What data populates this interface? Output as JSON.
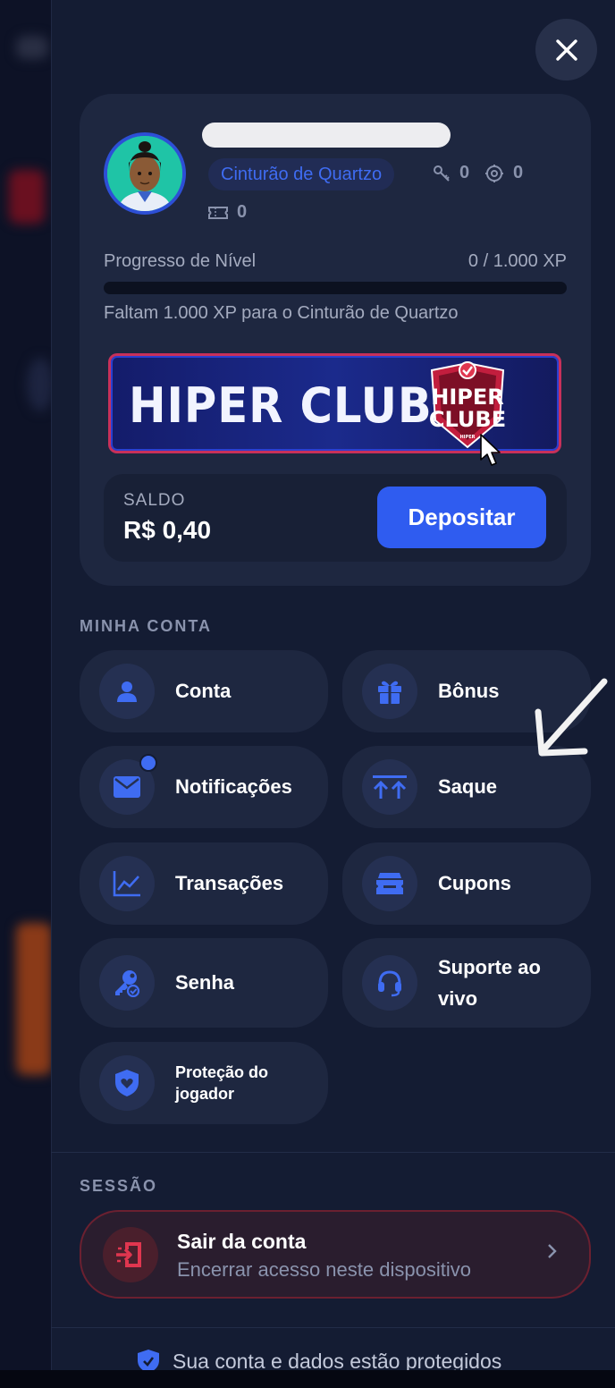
{
  "close_button": {
    "icon": "close-icon"
  },
  "profile": {
    "belt": "Cinturão de Quartzo",
    "keys": "0",
    "coins": "0",
    "tickets": "0",
    "level_label": "Progresso de Nível",
    "level_value": "0 / 1.000 XP",
    "level_progress": 0,
    "level_hint": "Faltam 1.000 XP para o Cinturão de Quartzo"
  },
  "banner": {
    "text": "HIPER CLUBE",
    "logo_top": "HIPER",
    "logo_bottom": "CLUBE",
    "logo_small": "HIPER"
  },
  "balance": {
    "label": "SALDO",
    "value": "R$ 0,40",
    "deposit_label": "Depositar"
  },
  "account_section": {
    "title": "MINHA CONTA",
    "items": [
      {
        "label": "Conta",
        "icon": "user-icon"
      },
      {
        "label": "Bônus",
        "icon": "gift-icon"
      },
      {
        "label": "Notificações",
        "icon": "mail-icon",
        "has_badge": true
      },
      {
        "label": "Saque",
        "icon": "withdraw-icon"
      },
      {
        "label": "Transações",
        "icon": "chart-icon"
      },
      {
        "label": "Cupons",
        "icon": "ticket-icon"
      },
      {
        "label": "Senha",
        "icon": "key-icon"
      },
      {
        "label": "Suporte ao vivo",
        "icon": "headset-icon"
      },
      {
        "label": "Proteção do jogador",
        "icon": "shield-heart-icon"
      }
    ]
  },
  "session_section": {
    "title": "SESSÃO",
    "logout_title": "Sair da conta",
    "logout_subtitle": "Encerrar acesso neste dispositivo"
  },
  "footer": {
    "text": "Sua conta e dados estão protegidos",
    "icon": "shield-icon"
  },
  "colors": {
    "accent": "#3f6cf2",
    "panel": "#141c33",
    "card": "#1e2740",
    "danger": "#e0364f"
  }
}
